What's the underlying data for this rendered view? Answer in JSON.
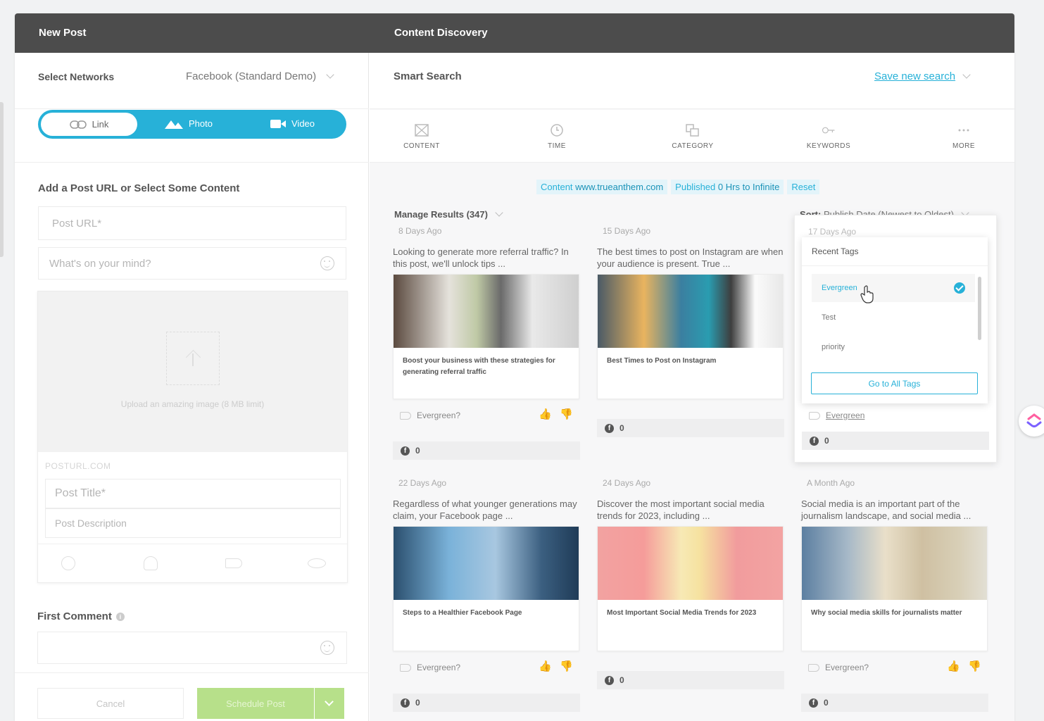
{
  "left_panel": {
    "title": "New Post",
    "networks_label": "Select Networks",
    "network_selected": "Facebook (Standard Demo)",
    "tabs": [
      {
        "label": "Link"
      },
      {
        "label": "Photo"
      },
      {
        "label": "Video"
      }
    ],
    "add_label": "Add a Post URL or Select Some Content",
    "url_placeholder": "Post URL*",
    "mind_placeholder": "What's on your mind?",
    "upload_text": "Upload an amazing image (8 MB limit)",
    "posturl": "POSTURL.COM",
    "title_placeholder": "Post Title*",
    "desc_placeholder": "Post Description",
    "first_comment_label": "First Comment",
    "cancel_label": "Cancel",
    "schedule_label": "Schedule Post"
  },
  "right_panel": {
    "title": "Content Discovery",
    "smart_search_label": "Smart Search",
    "save_search_label": "Save new search",
    "filters": [
      {
        "label": "CONTENT",
        "icon": "content-icon"
      },
      {
        "label": "TIME",
        "icon": "clock-icon"
      },
      {
        "label": "CATEGORY",
        "icon": "category-icon"
      },
      {
        "label": "KEYWORDS",
        "icon": "key-icon"
      },
      {
        "label": "MORE",
        "icon": "more-icon"
      }
    ],
    "chips": {
      "content_prefix": "Content",
      "content_value": "www.trueanthem.com",
      "published_prefix": "Published",
      "published_value": "0 Hrs to Infinite",
      "reset": "Reset"
    },
    "manage_label": "Manage Results (347)",
    "sort_label": "Sort:",
    "sort_value": "Publish Date (Newest to Oldest)",
    "cards": [
      {
        "ago": "8 Days Ago",
        "snippet": "Looking to generate more referral traffic? In this post, we'll unlock tips ...",
        "title": "Boost your business with these strategies for generating referral traffic",
        "evergreen": "Evergreen?",
        "count": "0"
      },
      {
        "ago": "15 Days Ago",
        "snippet": "The best times to post on Instagram are when your audience is present. True ...",
        "title": "Best Times to Post on Instagram",
        "count": "0"
      },
      {
        "ago": "17 Days Ago",
        "evergreen": "Evergreen",
        "count": "0"
      },
      {
        "ago": "22 Days Ago",
        "snippet": "Regardless of what younger generations may claim, your Facebook page ...",
        "title": "Steps to a Healthier Facebook Page",
        "evergreen": "Evergreen?",
        "count": "0"
      },
      {
        "ago": "24 Days Ago",
        "snippet": "Discover the most important social media trends for 2023, including ...",
        "title": "Most Important Social Media Trends for 2023",
        "count": "0"
      },
      {
        "ago": "A Month Ago",
        "snippet": "Social media is an important part of the journalism landscape, and social media ...",
        "title": "Why social media skills for journalists matter",
        "evergreen": "Evergreen?",
        "count": "0"
      }
    ],
    "tags_dropdown": {
      "title": "Recent Tags",
      "items": [
        "Evergreen",
        "Test",
        "priority"
      ],
      "button": "Go to All Tags"
    }
  },
  "colors": {
    "accent": "#27b1d8",
    "schedule": "#b7e08a",
    "topbar": "#4c4c4c"
  }
}
